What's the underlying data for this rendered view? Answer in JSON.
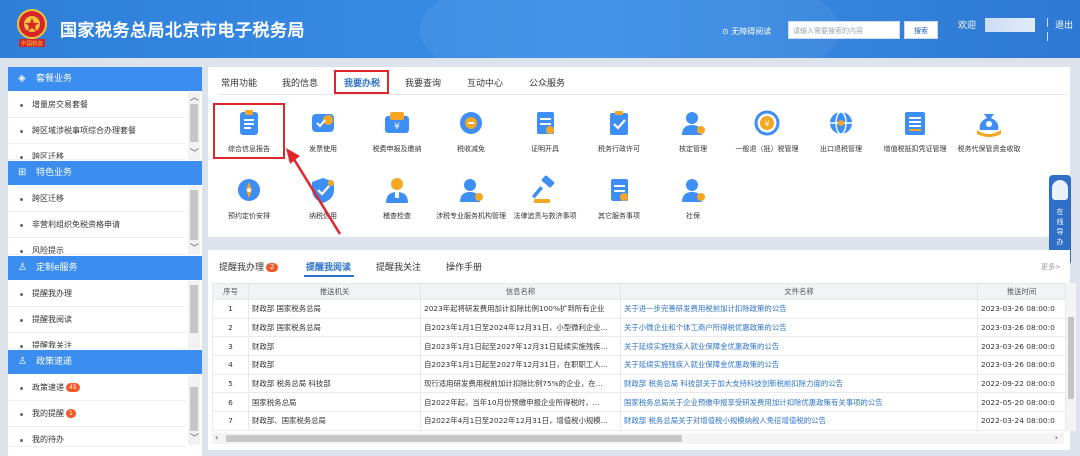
{
  "header": {
    "title": "国家税务总局北京市电子税务局",
    "emblem_caption": "中国税务",
    "accessibility": "无障碍阅读",
    "search_placeholder": "请输入需要搜索的内容",
    "search_button": "搜索",
    "welcome": "欢迎",
    "separator": "|",
    "logout": "退出"
  },
  "sidebar": {
    "sections": [
      {
        "title": "套餐业务",
        "icon": "layers-icon",
        "items": [
          "增量房交易套餐",
          "跨区域涉税事项综合办理套餐",
          "跨区迁移"
        ]
      },
      {
        "title": "特色业务",
        "icon": "grid-icon",
        "items": [
          "跨区迁移",
          "非营利组织免税资格申请",
          "风险提示"
        ]
      },
      {
        "title": "定制e服务",
        "icon": "user-icon",
        "items": [
          "提醒我办理",
          "提醒我阅读",
          "提醒我关注"
        ]
      },
      {
        "title": "政策速递",
        "icon": "user-icon",
        "items": [
          "政策速递",
          "我的提醒",
          "我的待办"
        ],
        "badges": [
          "45",
          "1",
          ""
        ]
      }
    ]
  },
  "tabs": [
    "常用功能",
    "我的信息",
    "我要办税",
    "我要查询",
    "互动中心",
    "公众服务"
  ],
  "active_tab": "我要办税",
  "functions": [
    {
      "label": "综合信息报告",
      "icon": "clipboard-icon"
    },
    {
      "label": "发票使用",
      "icon": "ticket-icon"
    },
    {
      "label": "税费申报及缴纳",
      "icon": "wallet-icon"
    },
    {
      "label": "税收减免",
      "icon": "coin-icon"
    },
    {
      "label": "证明开具",
      "icon": "document-icon"
    },
    {
      "label": "税务行政许可",
      "icon": "clipboard-check-icon"
    },
    {
      "label": "核定管理",
      "icon": "person-gear-icon"
    },
    {
      "label": "一般退（抵）税管理",
      "icon": "refund-icon"
    },
    {
      "label": "出口退税管理",
      "icon": "globe-icon"
    },
    {
      "label": "增值税抵扣凭证管理",
      "icon": "invoice-icon"
    },
    {
      "label": "税务代保管资金收取",
      "icon": "money-bag-icon"
    },
    {
      "label": "预约定价安排",
      "icon": "compass-icon"
    },
    {
      "label": "纳税信用",
      "icon": "shield-icon"
    },
    {
      "label": "稽查检查",
      "icon": "inspector-icon"
    },
    {
      "label": "涉税专业服务机构管理",
      "icon": "person-gear-icon"
    },
    {
      "label": "法律追责与救济事项",
      "icon": "gavel-icon"
    },
    {
      "label": "其它服务事项",
      "icon": "document-icon"
    },
    {
      "label": "社保",
      "icon": "person-gear-icon"
    }
  ],
  "float_guide": "在线导办",
  "reminder_tabs": [
    {
      "label": "提醒我办理",
      "badge": "2"
    },
    {
      "label": "提醒我阅读"
    },
    {
      "label": "提醒我关注"
    },
    {
      "label": "操作手册"
    }
  ],
  "more": "更多>",
  "table": {
    "headers": [
      "序号",
      "推送机关",
      "信息名称",
      "文件名称",
      "推送时间"
    ],
    "rows": [
      [
        "1",
        "财政部 国家税务总局",
        "2023年起将研发费用加计扣除比例100%扩到所有企业",
        "关于进一步完善研发费用税前加计扣除政策的公告",
        "2023-03-26 08:00:0"
      ],
      [
        "2",
        "财政部 国家税务总局",
        "自2023年1月1日至2024年12月31日，小型微利企业...",
        "关于小微企业和个体工商户所得税优惠政策的公告",
        "2023-03-26 08:00:0"
      ],
      [
        "3",
        "财政部",
        "自2023年1月1日起至2027年12月31日延续实施残疾...",
        "关于延续实施残疾人就业保障金优惠政策的公告",
        "2023-03-26 08:00:0"
      ],
      [
        "4",
        "财政部",
        "自2023年1月1日起至2027年12月31日，在职职工人...",
        "关于延续实施残疾人就业保障金优惠政策的公告",
        "2023-03-26 08:00:0"
      ],
      [
        "5",
        "财政部 税务总局 科技部",
        "现行适用研发费用税前加计扣除比例75%的企业，在...",
        "财政部 税务总局 科技部关于加大支持科技创新税前扣除力度的公告",
        "2022-09-22 08:00:0"
      ],
      [
        "6",
        "国家税务总局",
        "自2022年起，当年10月份预缴申报企业所得税时，...",
        "国家税务总局关于企业预缴申报享受研发费用加计扣除优惠政策有关事项的公告",
        "2022-05-20 08:00:0"
      ],
      [
        "7",
        "财政部、国家税务总局",
        "自2022年4月1日至2022年12月31日，增值税小规模...",
        "财政部 税务总局关于对增值税小规模纳税人免征增值税的公告",
        "2022-03-24 08:00:0"
      ]
    ]
  },
  "colors": {
    "header_blue": "#2f7fd8",
    "sidebar_head": "#3b8df0",
    "accent": "#2e73c8",
    "highlight_red": "#e0262d",
    "icon_orange": "#f5a623",
    "icon_blue": "#3d8ef5"
  }
}
